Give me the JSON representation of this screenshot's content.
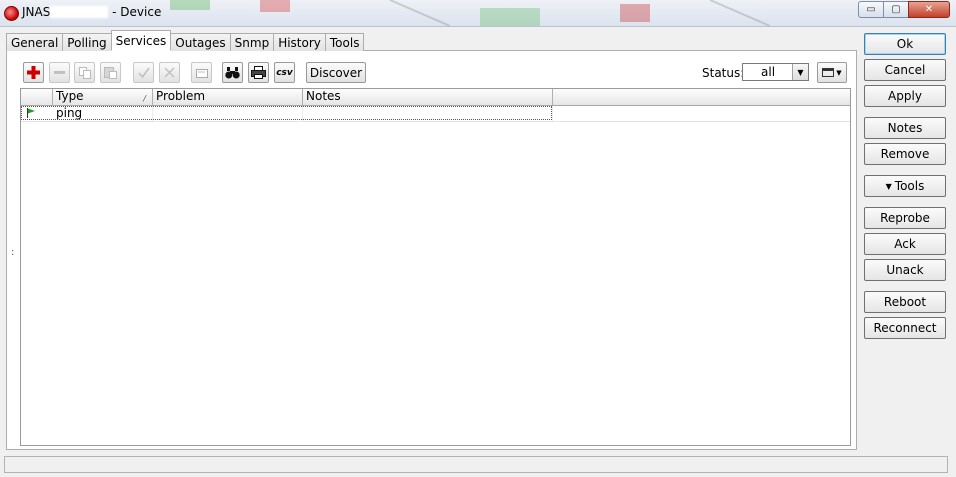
{
  "window": {
    "title_prefix": "JNAS",
    "title_suffix": " - Device",
    "controls": {
      "minimize": "▭",
      "maximize": "▢",
      "close": "✕"
    }
  },
  "tabs": [
    {
      "label": "General"
    },
    {
      "label": "Polling"
    },
    {
      "label": "Services",
      "active": true
    },
    {
      "label": "Outages"
    },
    {
      "label": "Snmp"
    },
    {
      "label": "History"
    },
    {
      "label": "Tools"
    }
  ],
  "toolbar": {
    "icons": {
      "add": "plus-icon",
      "remove": "minus-icon",
      "copy": "copy-icon",
      "paste": "paste-icon",
      "ack": "check-icon",
      "unack": "x-icon",
      "comment": "note-icon",
      "find": "binoculars-icon",
      "print": "printer-icon",
      "export": "csv-icon"
    },
    "csv_label": "csv",
    "discover_label": "Discover",
    "status_label": "Status:",
    "status_value": "all"
  },
  "grid": {
    "columns": [
      "Type",
      "Problem",
      "Notes"
    ],
    "sort_indicator": "/",
    "rows": [
      {
        "type": "ping",
        "problem": "",
        "notes": "",
        "status_color": "#22a022"
      }
    ]
  },
  "buttons": {
    "ok": "Ok",
    "cancel": "Cancel",
    "apply": "Apply",
    "notes": "Notes",
    "remove": "Remove",
    "tools": "Tools",
    "reprobe": "Reprobe",
    "ack": "Ack",
    "unack": "Unack",
    "reboot": "Reboot",
    "reconnect": "Reconnect"
  },
  "splitter": ":"
}
